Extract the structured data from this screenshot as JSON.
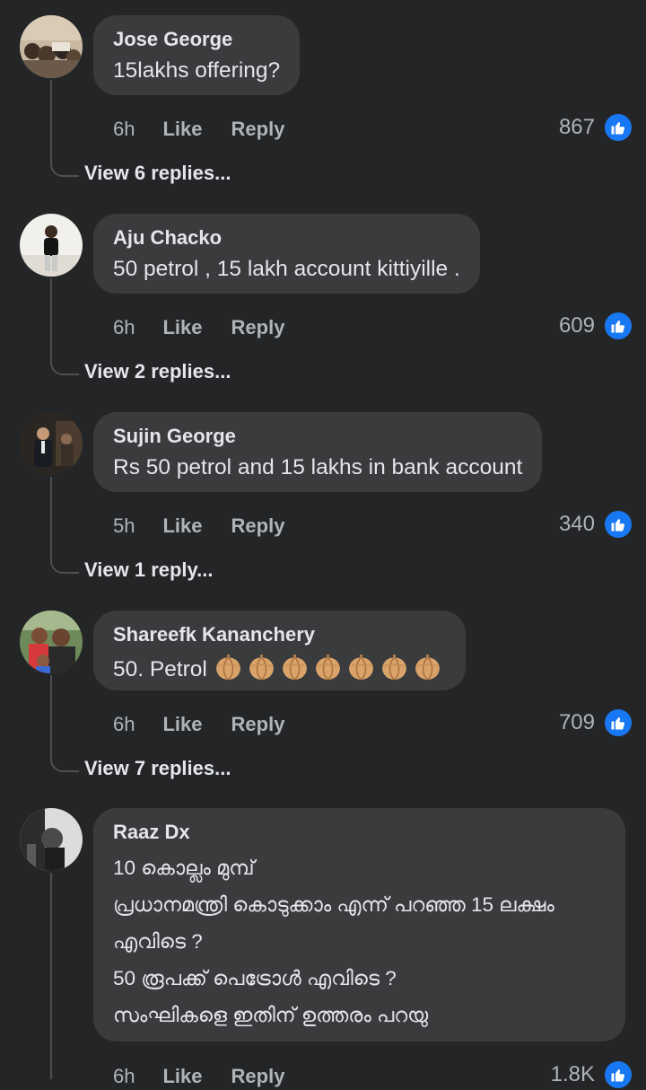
{
  "comments": [
    {
      "name": "Jose George",
      "text": "15lakhs offering?",
      "time": "6h",
      "like_label": "Like",
      "reply_label": "Reply",
      "reaction_count": "867",
      "view_replies": "View 6 replies..."
    },
    {
      "name": "Aju Chacko",
      "text": "50 petrol , 15 lakh account kittiyille  .",
      "time": "6h",
      "like_label": "Like",
      "reply_label": "Reply",
      "reaction_count": "609",
      "view_replies": "View 2 replies..."
    },
    {
      "name": "Sujin George",
      "text": "Rs 50 petrol and 15 lakhs in bank account",
      "time": "5h",
      "like_label": "Like",
      "reply_label": "Reply",
      "reaction_count": "340",
      "view_replies": "View 1 reply..."
    },
    {
      "name": "Shareefk Kananchery",
      "text": "50. Petrol",
      "emoji": "onion",
      "emoji_count": 7,
      "time": "6h",
      "like_label": "Like",
      "reply_label": "Reply",
      "reaction_count": "709",
      "view_replies": "View 7 replies..."
    },
    {
      "name": "Raaz Dx",
      "lines": [
        "10 കൊല്ലം മുമ്പ്",
        "പ്രധാനമന്ത്രി കൊടുക്കാം എന്ന് പറഞ്ഞ 15 ലക്ഷം",
        "എവിടെ ?",
        "50 രൂപക്ക് പെട്രോൾ എവിടെ ?",
        "സംഘികളെ ഇതിന് ഉത്തരം പറയു"
      ],
      "time": "6h",
      "like_label": "Like",
      "reply_label": "Reply",
      "reaction_count": "1.8K"
    }
  ],
  "colors": {
    "background": "#242526",
    "bubble": "#3a3b3c",
    "primary_text": "#e4e6eb",
    "secondary_text": "#b0b3b8",
    "like_blue": "#1877f2"
  },
  "icons": {
    "reaction": "thumbs-up-icon",
    "emoji": "onion-icon"
  }
}
